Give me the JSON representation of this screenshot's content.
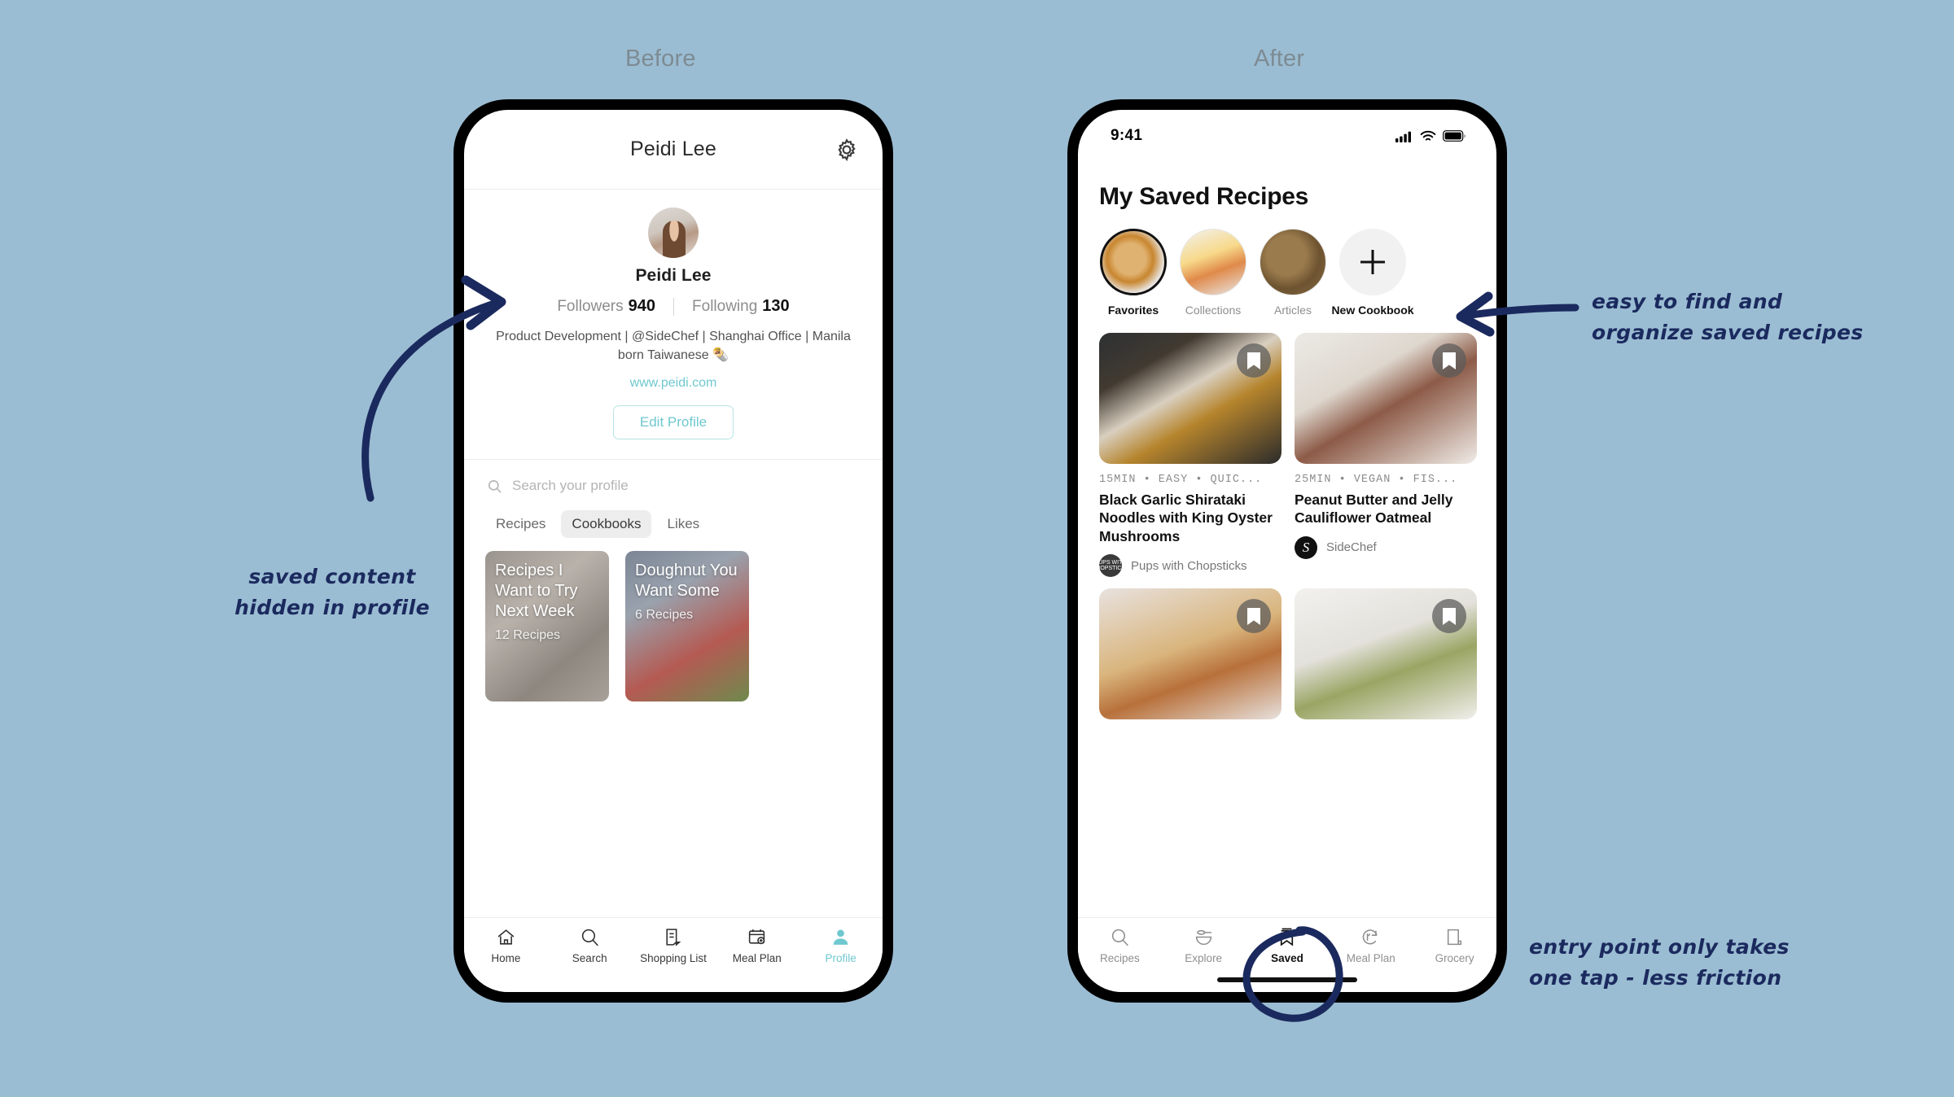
{
  "captions": {
    "before": "Before",
    "after": "After"
  },
  "before": {
    "topbar": {
      "title": "Peidi Lee",
      "settings_icon": "gear-icon"
    },
    "profile": {
      "avatar": "user-avatar",
      "name": "Peidi Lee",
      "followers_label": "Followers",
      "followers_count": "940",
      "following_label": "Following",
      "following_count": "130",
      "bio": "Product Development | @SideChef | Shanghai Office | Manila born Taiwanese 🌯",
      "website": "www.peidi.com",
      "edit_button": "Edit Profile"
    },
    "search": {
      "placeholder": "Search your profile",
      "icon": "search-icon"
    },
    "tabs": [
      {
        "label": "Recipes",
        "active": false
      },
      {
        "label": "Cookbooks",
        "active": true
      },
      {
        "label": "Likes",
        "active": false
      }
    ],
    "cookbooks": [
      {
        "title": "Recipes I Want to Try Next Week",
        "count": "12 Recipes"
      },
      {
        "title": "Doughnut You Want Some",
        "count": "6 Recipes"
      }
    ],
    "nav": [
      {
        "label": "Home",
        "icon": "home-icon",
        "active": false
      },
      {
        "label": "Search",
        "icon": "search-icon",
        "active": false
      },
      {
        "label": "Shopping List",
        "icon": "list-icon",
        "active": false
      },
      {
        "label": "Meal Plan",
        "icon": "calendar-plus-icon",
        "active": false
      },
      {
        "label": "Profile",
        "icon": "person-icon",
        "active": true
      }
    ],
    "accent_color": "#6fc8cf"
  },
  "after": {
    "status": {
      "time": "9:41",
      "cellular": "signal-icon",
      "wifi": "wifi-icon",
      "battery": "battery-icon"
    },
    "heading": "My Saved Recipes",
    "categories": [
      {
        "label": "Favorites",
        "active": true
      },
      {
        "label": "Collections",
        "active": false
      },
      {
        "label": "Articles",
        "active": false
      },
      {
        "label": "New Cookbook",
        "active": false,
        "icon": "plus-icon"
      }
    ],
    "recipes": [
      {
        "meta": "15MIN • EASY • QUIC...",
        "title": "Black Garlic Shirataki Noodles with King Oyster Mushrooms",
        "author": "Pups with Chopsticks",
        "author_badge": "PUPS WITH CHOPSTICKS",
        "bookmark": "bookmark-icon"
      },
      {
        "meta": "25MIN • VEGAN • FIS...",
        "title": "Peanut Butter and Jelly Cauliflower Oatmeal",
        "author": "SideChef",
        "author_badge": "S",
        "bookmark": "bookmark-icon"
      },
      {
        "meta": "",
        "title": "",
        "author": "",
        "bookmark": "bookmark-icon"
      },
      {
        "meta": "",
        "title": "",
        "author": "",
        "bookmark": "bookmark-icon"
      }
    ],
    "nav": [
      {
        "label": "Recipes",
        "icon": "search-icon",
        "active": false
      },
      {
        "label": "Explore",
        "icon": "bowl-spoon-icon",
        "active": false
      },
      {
        "label": "Saved",
        "icon": "bookmark-icon",
        "active": true
      },
      {
        "label": "Meal Plan",
        "icon": "meal-plan-icon",
        "active": false
      },
      {
        "label": "Grocery",
        "icon": "grocery-icon",
        "active": false
      }
    ]
  },
  "annotations": {
    "left": "saved content\nhidden in profile",
    "top_right": "easy to find and\norganize saved recipes",
    "bottom_right": "entry point only takes\none tap - less friction"
  },
  "colors": {
    "background": "#9bbdd3",
    "ink": "#1b2a5e",
    "accent": "#6fc8cf"
  }
}
